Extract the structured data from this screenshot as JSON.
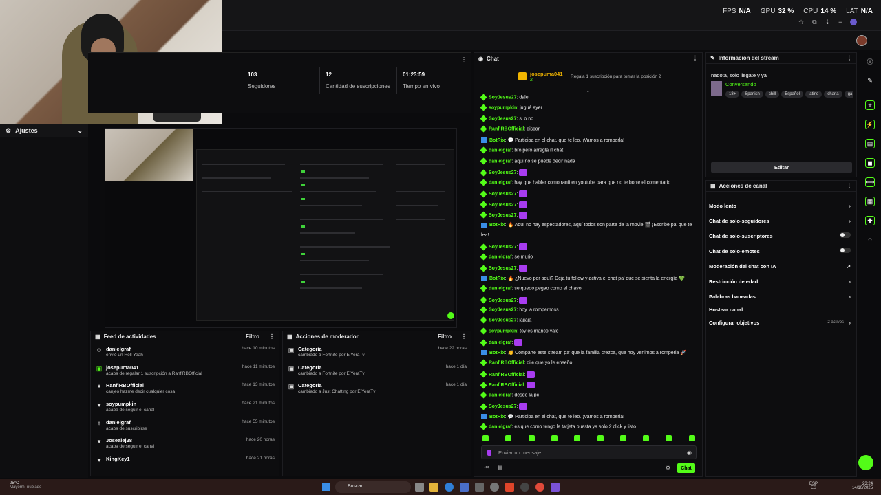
{
  "perf": {
    "fps_label": "FPS",
    "fps": "N/A",
    "gpu_label": "GPU",
    "gpu": "32 %",
    "cpu_label": "CPU",
    "cpu": "14 %",
    "lat_label": "LAT",
    "lat": "N/A"
  },
  "sidebar": {
    "ajustes": "Ajustes"
  },
  "stats": [
    {
      "value": "103",
      "label": "Seguidores"
    },
    {
      "value": "12",
      "label": "Cantidad de suscripciones"
    },
    {
      "value": "01:23:59",
      "label": "Tiempo en vivo"
    }
  ],
  "feed": {
    "title": "Feed de actividades",
    "filter": "Filtro",
    "items": [
      {
        "name": "danielgraf",
        "sub": "envió un Hell Yeah",
        "time": "hace 10 minutos",
        "icon": "sticker-icon"
      },
      {
        "name": "josepuma041",
        "sub": "acaba de regalar 1 suscripción a RanflRBOfficial",
        "time": "hace 11 minutos",
        "icon": "gift-icon"
      },
      {
        "name": "RanflRBOfficial",
        "sub": "canjeó hazme decir cualquier cosa",
        "time": "hace 13 minutos",
        "icon": "redeem-icon"
      },
      {
        "name": "soypumpkin",
        "sub": "acaba de seguir el canal",
        "time": "hace 21 minutos",
        "icon": "heart-icon"
      },
      {
        "name": "danielgraf",
        "sub": "acaba de suscribirse",
        "time": "hace 55 minutos",
        "icon": "star-icon"
      },
      {
        "name": "Josealej28",
        "sub": "acaba de seguir el canal",
        "time": "hace 20 horas",
        "icon": "heart-icon"
      },
      {
        "name": "KingKey1",
        "sub": "",
        "time": "hace 21 horas",
        "icon": "heart-icon"
      }
    ]
  },
  "mod": {
    "title": "Acciones de moderador",
    "filter": "Filtro",
    "items": [
      {
        "name": "Categoría",
        "sub": "cambiado a Fortnite por ElYeraTv",
        "time": "hace 22 horas"
      },
      {
        "name": "Categoría",
        "sub": "cambiado a Fortnite por ElYeraTv",
        "time": "hace 1 día"
      },
      {
        "name": "Categoría",
        "sub": "cambiado a Just Chatting por ElYeraTv",
        "time": "hace 1 día"
      }
    ]
  },
  "chat": {
    "title": "Chat",
    "pinned_user": "josepuma041",
    "pinned_count": "2",
    "pinned_text": "Regala 1 suscripción para tomar la posición 2",
    "messages": [
      {
        "u": "SoyJesus27",
        "t": "dale"
      },
      {
        "u": "soypumpkin",
        "t": "jugué ayer"
      },
      {
        "u": "SoyJesus27",
        "t": "si o no"
      },
      {
        "u": "RanflRBOfficial",
        "t": "discor"
      },
      {
        "u": "BotRix",
        "t": "💬 Participa en el chat, que te leo. ¡Vamos a romperla!"
      },
      {
        "u": "danielgraf",
        "t": "bro pero arregla rl chat"
      },
      {
        "u": "danielgraf",
        "t": "aqui no se puede decir nada"
      },
      {
        "u": "SoyJesus27",
        "t": ""
      },
      {
        "u": "danielgraf",
        "t": "hay que hablar como ranfi en youtube para que no te borre el comentario"
      },
      {
        "u": "SoyJesus27",
        "t": ""
      },
      {
        "u": "SoyJesus27",
        "t": ""
      },
      {
        "u": "SoyJesus27",
        "t": ""
      },
      {
        "u": "BotRix",
        "t": "🔥 Aquí no hay espectadores, aquí todos son parte de la movie 🎬 ¡Escribe pa' que te"
      },
      {
        "u": "",
        "t": "lea!"
      },
      {
        "u": "SoyJesus27",
        "t": ""
      },
      {
        "u": "danielgraf",
        "t": "se murio"
      },
      {
        "u": "SoyJesus27",
        "t": ""
      },
      {
        "u": "BotRix",
        "t": "🔥 ¿Nuevo por aquí? Deja tu follow y activa el chat pa' que se sienta la energía 💚"
      },
      {
        "u": "danielgraf",
        "t": "se quedo pegao como el chavo"
      },
      {
        "u": "SoyJesus27",
        "t": ""
      },
      {
        "u": "SoyJesus27",
        "t": "hoy la rompemoss"
      },
      {
        "u": "SoyJesus27",
        "t": "jajjaja"
      },
      {
        "u": "soypumpkin",
        "t": "toy es manco vale"
      },
      {
        "u": "danielgraf",
        "t": ""
      },
      {
        "u": "BotRix",
        "t": "👏 Comparte este stream pa' que la familia crezca, que hoy venimos a romperla 🚀"
      },
      {
        "u": "RanflRBOfficial",
        "t": "dile que yo le enseño"
      },
      {
        "u": "RanflRBOfficial",
        "t": ""
      },
      {
        "u": "RanflRBOfficial",
        "t": ""
      },
      {
        "u": "danielgraf",
        "t": "desde la pc"
      },
      {
        "u": "SoyJesus27",
        "t": ""
      },
      {
        "u": "BotRix",
        "t": "💬 Participa en el chat, que te leo. ¡Vamos a romperla!"
      },
      {
        "u": "danielgraf",
        "t": "es que como tengo la tarjeta puesta ya solo 2 click y listo"
      }
    ],
    "placeholder": "Enviar un mensaje",
    "send": "Chat"
  },
  "info": {
    "title": "Información del stream",
    "stream_title": "nadota, solo llegate y ya",
    "category": "Conversando",
    "tags": [
      "18+",
      "Spanish",
      "chill",
      "Español",
      "latino",
      "charla",
      "ga"
    ],
    "edit": "Editar"
  },
  "canal": {
    "title": "Acciones de canal",
    "items": [
      "Modo lento",
      "Chat de solo-seguidores",
      "Chat de solo-suscriptores",
      "Chat de solo-emotes",
      "Moderación del chat con IA",
      "Restricción de edad",
      "Palabras baneadas",
      "Hostear canal",
      "Configurar objetivos"
    ],
    "objetivos_badge": "2 activos"
  },
  "taskbar": {
    "weather_temp": "25°C",
    "weather_desc": "Mayorm. nublado",
    "search": "Buscar",
    "lang1": "ESP",
    "lang2": "ES",
    "time": "23:24",
    "date": "14/10/2025"
  },
  "colors": {
    "accent": "#53fc18",
    "bg": "#0d0d0f"
  }
}
